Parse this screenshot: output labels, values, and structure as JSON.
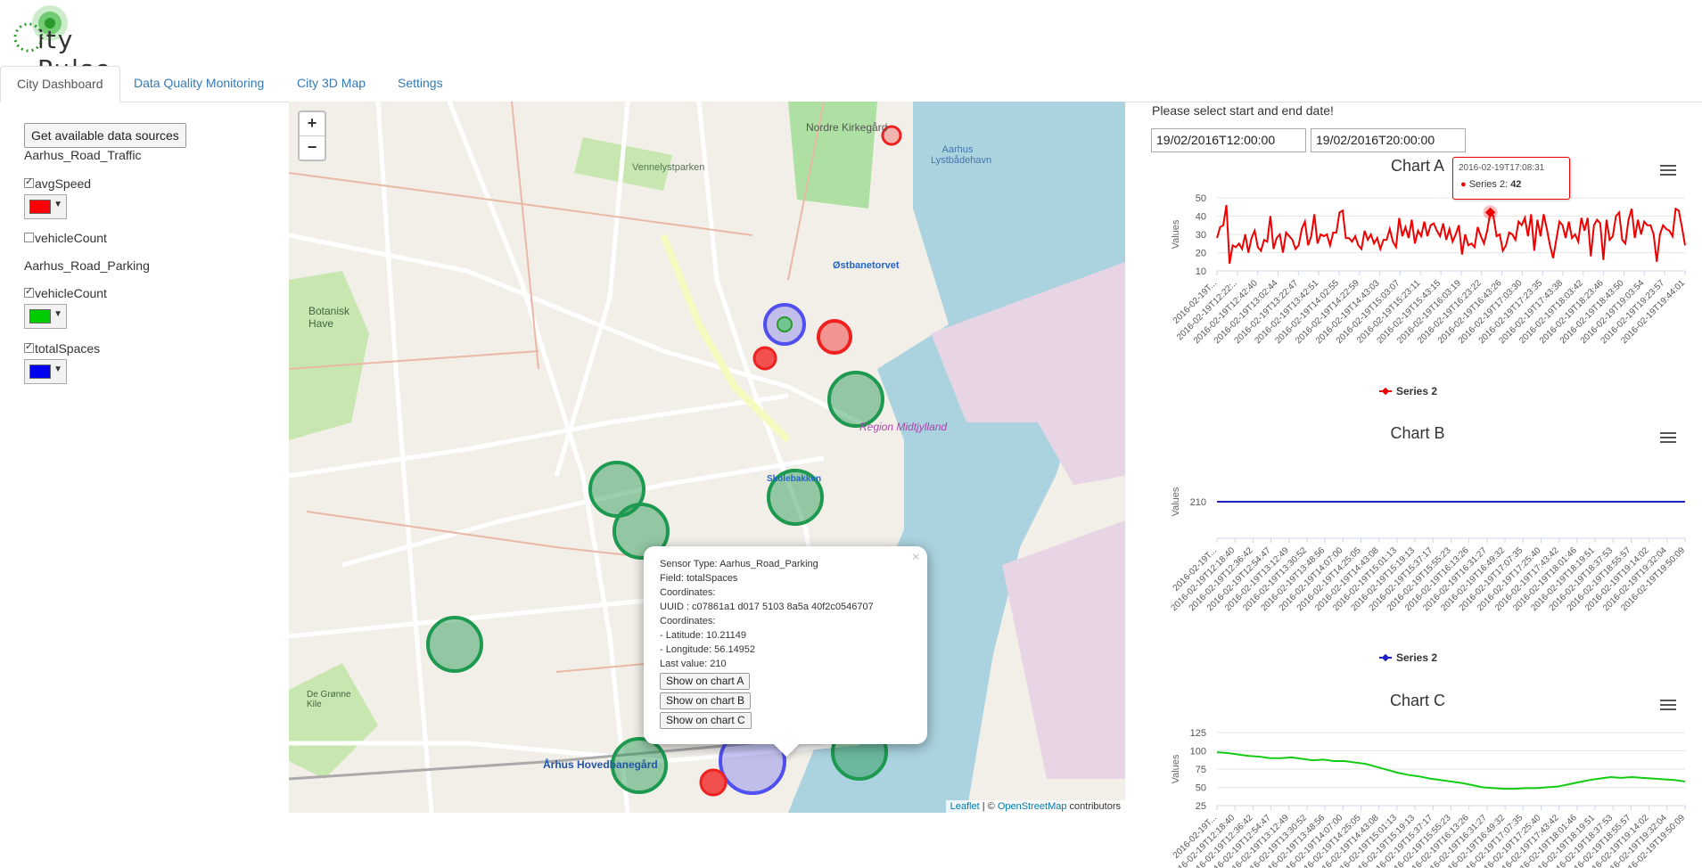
{
  "app": {
    "logo_text": "ity Pulse"
  },
  "tabs": [
    {
      "label": "City Dashboard",
      "active": true
    },
    {
      "label": "Data Quality Monitoring"
    },
    {
      "label": "City 3D Map"
    },
    {
      "label": "Settings"
    }
  ],
  "sidebar": {
    "get_sources_label": "Get available data sources",
    "groups": [
      {
        "name": "Aarhus_Road_Traffic",
        "fields": [
          {
            "label": "avgSpeed",
            "checked": true,
            "color": "#ff0000"
          },
          {
            "label": "vehicleCount",
            "checked": false
          }
        ]
      },
      {
        "name": "Aarhus_Road_Parking",
        "fields": [
          {
            "label": "vehicleCount",
            "checked": true,
            "color": "#00cc00"
          },
          {
            "label": "totalSpaces",
            "checked": true,
            "color": "#0000ee"
          }
        ]
      }
    ]
  },
  "map": {
    "zoom_in": "+",
    "zoom_out": "−",
    "attribution": {
      "leaflet": "Leaflet",
      "sep": " | © ",
      "osm": "OpenStreetMap",
      "suffix": " contributors"
    },
    "labels": {
      "cemetery": "Nordre Kirkegård",
      "lake": "Aarhus Lystbådehavn",
      "park": "Vennelystparken",
      "station": "Østbanetorvet",
      "region": "Region Midtjylland",
      "botanic": "Botanisk Have",
      "skolebakken": "Skolebakken",
      "central": "Århus Hovedbanegård",
      "green": "De Grønne Kile"
    },
    "popup": {
      "close": "×",
      "lines": [
        "Sensor Type: Aarhus_Road_Parking",
        "Field: totalSpaces",
        "Coordinates:",
        "UUID : c07861a1 d017 5103 8a5a 40f2c0546707",
        "Coordinates:",
        "- Latitude: 10.21149",
        "- Longitude: 56.14952",
        "Last value: 210"
      ],
      "buttons": [
        "Show on chart A",
        "Show on chart B",
        "Show on chart C"
      ]
    }
  },
  "right": {
    "prompt": "Please select start and end date!",
    "start_date": "19/02/2016T12:00:00",
    "end_date": "19/02/2016T20:00:00"
  },
  "tooltip": {
    "time": "2016-02-19T17:08:31",
    "series": "Series 2: ",
    "value": "42"
  },
  "chart_data": [
    {
      "type": "line",
      "title": "Chart A",
      "ylabel": "Values",
      "ylim": [
        10,
        50
      ],
      "yticks": [
        10,
        20,
        30,
        40,
        50
      ],
      "color": "#ee0000",
      "legend": "Series 2",
      "xticks": [
        "2016-02-19T...",
        "2016-02-19T12:22:..",
        "2016-02-19T12:42:40",
        "2016-02-19T13:02:44",
        "2016-02-19T13:22:47",
        "2016-02-19T13:42:51",
        "2016-02-19T14:02:55",
        "2016-02-19T14:22:59",
        "2016-02-19T14:43:03",
        "2016-02-19T15:03:07",
        "2016-02-19T15:23:11",
        "2016-02-19T15:43:15",
        "2016-02-19T16:03:19",
        "2016-02-19T16:23:22",
        "2016-02-19T16:43:26",
        "2016-02-19T17:03:30",
        "2016-02-19T17:23:35",
        "2016-02-19T17:43:38",
        "2016-02-19T18:03:42",
        "2016-02-19T18:23:46",
        "2016-02-19T18:43:50",
        "2016-02-19T19:03:54",
        "2016-02-19T19:23:57",
        "2016-02-19T19:44:01"
      ],
      "values": [
        28,
        34,
        35,
        46,
        14,
        24,
        23,
        25,
        22,
        30,
        20,
        28,
        32,
        23,
        21,
        27,
        26,
        40,
        22,
        28,
        30,
        20,
        31,
        29,
        27,
        22,
        24,
        33,
        37,
        24,
        29,
        41,
        25,
        30,
        29,
        30,
        24,
        31,
        31,
        42,
        43,
        28,
        28,
        26,
        29,
        24,
        22,
        32,
        27,
        30,
        25,
        28,
        22,
        27,
        27,
        33,
        26,
        23,
        39,
        29,
        34,
        28,
        38,
        25,
        32,
        29,
        37,
        29,
        35,
        36,
        32,
        29,
        36,
        27,
        33,
        26,
        30,
        35,
        19,
        30,
        24,
        25,
        23,
        34,
        29,
        25,
        32,
        42,
        40,
        29,
        30,
        21,
        24,
        31,
        30,
        27,
        37,
        35,
        39,
        29,
        41,
        21,
        38,
        29,
        41,
        33,
        24,
        17,
        27,
        37,
        35,
        28,
        37,
        28,
        30,
        26,
        39,
        32,
        39,
        18,
        35,
        38,
        36,
        16,
        38,
        27,
        29,
        40,
        42,
        27,
        25,
        38,
        44,
        28,
        38,
        30,
        37,
        35,
        35,
        30,
        15,
        30,
        35,
        33,
        32,
        29,
        44,
        43,
        34,
        24
      ]
    },
    {
      "type": "line",
      "title": "Chart B",
      "ylabel": "Values",
      "ylim": [
        205,
        215
      ],
      "yticks": [
        210
      ],
      "color": "#2020c0",
      "legend": "Series 2",
      "xticks": [
        "2016-02-19T...",
        "2016-02-19T12:18:40",
        "2016-02-19T12:36:42",
        "2016-02-19T12:54:47",
        "2016-02-19T13:12:49",
        "2016-02-19T13:30:52",
        "2016-02-19T13:48:56",
        "2016-02-19T14:07:00",
        "2016-02-19T14:25:05",
        "2016-02-19T14:43:08",
        "2016-02-19T15:01:13",
        "2016-02-19T15:19:13",
        "2016-02-19T15:37:17",
        "2016-02-19T15:55:23",
        "2016-02-19T16:13:26",
        "2016-02-19T16:31:27",
        "2016-02-19T16:49:32",
        "2016-02-19T17:07:35",
        "2016-02-19T17:25:40",
        "2016-02-19T17:43:42",
        "2016-02-19T18:01:46",
        "2016-02-19T18:19:51",
        "2016-02-19T18:37:53",
        "2016-02-19T18:55:57",
        "2016-02-19T19:14:02",
        "2016-02-19T19:32:04",
        "2016-02-19T19:50:09"
      ],
      "values": [
        210,
        210,
        210,
        210,
        210,
        210,
        210,
        210,
        210,
        210
      ]
    },
    {
      "type": "line",
      "title": "Chart C",
      "ylabel": "Values",
      "ylim": [
        25,
        125
      ],
      "yticks": [
        25,
        50,
        75,
        100,
        125
      ],
      "color": "#11cc11",
      "xticks": [
        "2016-02-19T...",
        "2016-02-19T12:18:40",
        "2016-02-19T12:36:42",
        "2016-02-19T12:54:47",
        "2016-02-19T13:12:49",
        "2016-02-19T13:30:52",
        "2016-02-19T13:48:56",
        "2016-02-19T14:07:00",
        "2016-02-19T14:25:05",
        "2016-02-19T14:43:08",
        "2016-02-19T15:01:13",
        "2016-02-19T15:19:13",
        "2016-02-19T15:37:17",
        "2016-02-19T15:55:23",
        "2016-02-19T16:13:26",
        "2016-02-19T16:31:27",
        "2016-02-19T16:49:32",
        "2016-02-19T17:07:35",
        "2016-02-19T17:25:40",
        "2016-02-19T17:43:42",
        "2016-02-19T18:01:46",
        "2016-02-19T18:19:51",
        "2016-02-19T18:37:53",
        "2016-02-19T18:55:57",
        "2016-02-19T19:14:02",
        "2016-02-19T19:32:04",
        "2016-02-19T19:50:09"
      ],
      "values": [
        98,
        97,
        95,
        93,
        92,
        90,
        90,
        91,
        89,
        87,
        88,
        86,
        86,
        84,
        82,
        78,
        74,
        70,
        67,
        65,
        62,
        60,
        58,
        56,
        53,
        50,
        49,
        48,
        48,
        49,
        49,
        50,
        51,
        54,
        57,
        60,
        62,
        64,
        63,
        64,
        63,
        62,
        61,
        60,
        58
      ]
    }
  ]
}
